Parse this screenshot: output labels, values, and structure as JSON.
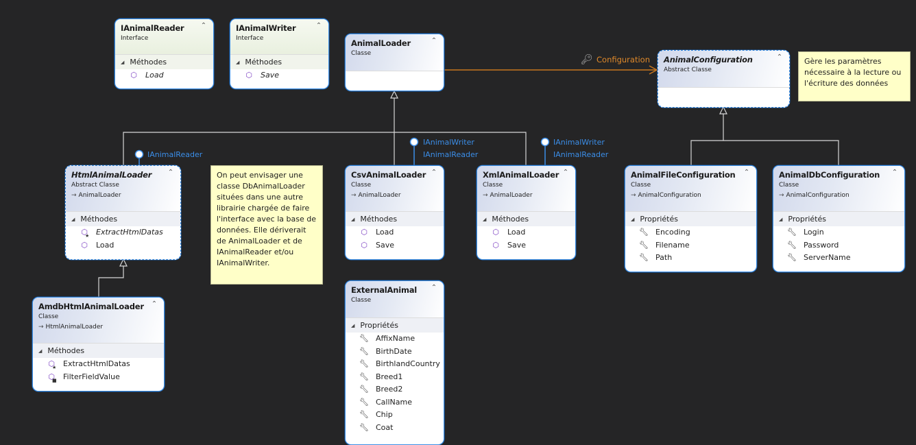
{
  "diagram": {
    "type": "class-diagram",
    "labels": {
      "methods": "Méthodes",
      "properties": "Propriétés"
    },
    "shapes": {
      "ianimalreader": {
        "name": "IAnimalReader",
        "kind": "Interface",
        "members": [
          "Load"
        ]
      },
      "ianimalwriter": {
        "name": "IAnimalWriter",
        "kind": "Interface",
        "members": [
          "Save"
        ]
      },
      "animalloader": {
        "name": "AnimalLoader",
        "kind": "Classe"
      },
      "animalconfiguration": {
        "name": "AnimalConfiguration",
        "kind": "Abstract Classe"
      },
      "htmlanimalloader": {
        "name": "HtmlAnimalLoader",
        "kind": "Abstract Classe",
        "base": "AnimalLoader",
        "members": [
          "ExtractHtmlDatas",
          "Load"
        ]
      },
      "csvanimalloader": {
        "name": "CsvAnimalLoader",
        "kind": "Classe",
        "base": "AnimalLoader",
        "members": [
          "Load",
          "Save"
        ]
      },
      "xmlanimalloader": {
        "name": "XmlAnimalLoader",
        "kind": "Classe",
        "base": "AnimalLoader",
        "members": [
          "Load",
          "Save"
        ]
      },
      "animalfileconfiguration": {
        "name": "AnimalFileConfiguration",
        "kind": "Classe",
        "base": "AnimalConfiguration",
        "members": [
          "Encoding",
          "Filename",
          "Path"
        ]
      },
      "animaldbconfiguration": {
        "name": "AnimalDbConfiguration",
        "kind": "Classe",
        "base": "AnimalConfiguration",
        "members": [
          "Login",
          "Password",
          "ServerName"
        ]
      },
      "amdbhtmlanimalloader": {
        "name": "AmdbHtmlAnimalLoader",
        "kind": "Classe",
        "base": "HtmlAnimalLoader",
        "members": [
          "ExtractHtmlDatas",
          "FilterFieldValue"
        ]
      },
      "externalanimal": {
        "name": "ExternalAnimal",
        "kind": "Classe",
        "members": [
          "AffixName",
          "BirthDate",
          "BirthlandCountry",
          "Breed1",
          "Breed2",
          "CallName",
          "Chip",
          "Coat"
        ]
      }
    },
    "association": {
      "label": "Configuration",
      "from": "AnimalLoader",
      "to": "AnimalConfiguration"
    },
    "lollipops": {
      "html": [
        "IAnimalReader"
      ],
      "csv": [
        "IAnimalWriter",
        "IAnimalReader"
      ],
      "xml": [
        "IAnimalWriter",
        "IAnimalReader"
      ]
    },
    "notes": {
      "config": "Gère les paramètres nécessaire à la lecture ou l'écriture des données",
      "db": "On peut envisager une classe DbAnimalLoader situées dans une autre librairie chargée de faire l'interface avec la base de données. Elle dériverait de AnimalLoader et de IAnimalReader et/ou IAnimalWriter."
    },
    "colors": {
      "background": "#252526",
      "shape_border": "#3a8ee6",
      "association": "#c8761e",
      "association_label": "#e0892a",
      "lollipop": "#3b8ee8",
      "note_bg": "#ffffc8",
      "method_icon": "#7b3fc2"
    }
  }
}
